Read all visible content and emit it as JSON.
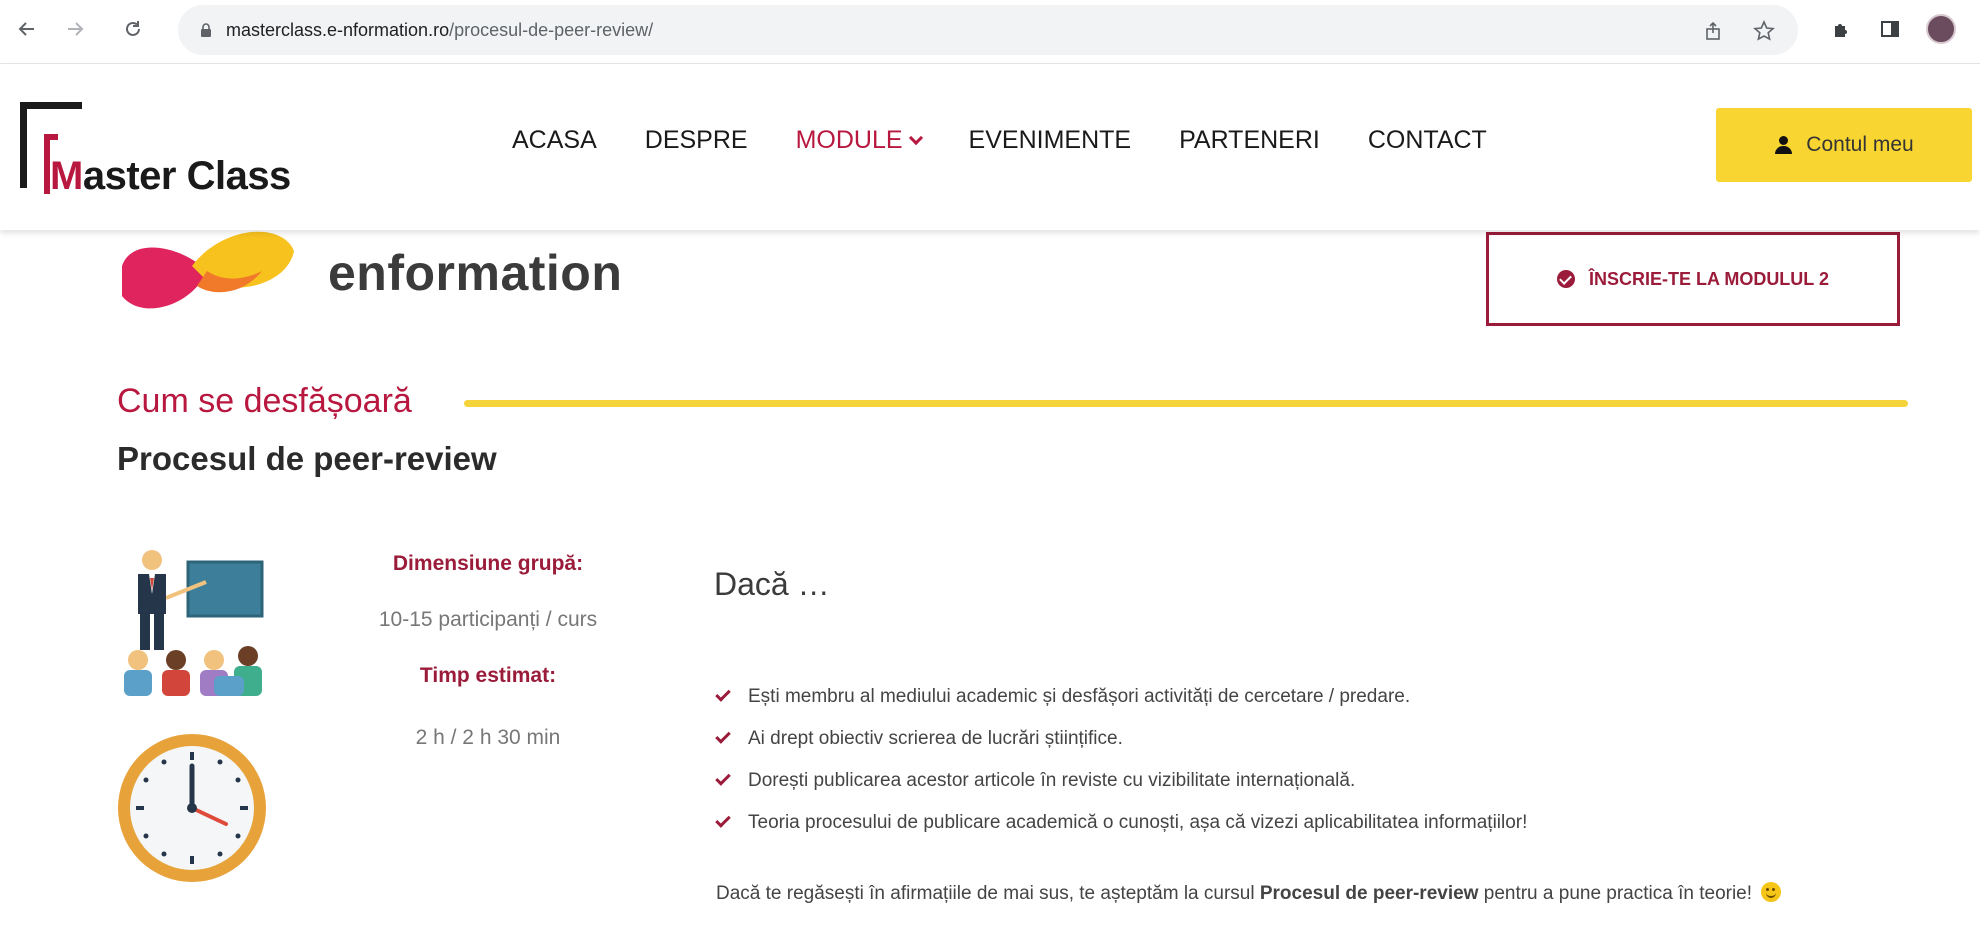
{
  "browser": {
    "url_domain": "masterclass.e-nformation.ro",
    "url_path": "/procesul-de-peer-review/",
    "icons": [
      "back-arrow-icon",
      "forward-arrow-icon",
      "reload-icon",
      "lock-icon",
      "share-icon",
      "star-icon",
      "puzzle-extension-icon",
      "side-panel-icon",
      "profile-avatar-icon"
    ]
  },
  "header": {
    "logo_text_m": "M",
    "logo_text_rest": "aster Class",
    "nav": [
      {
        "label": "ACASA"
      },
      {
        "label": "DESPRE"
      },
      {
        "label": "MODULE"
      },
      {
        "label": "EVENIMENTE"
      },
      {
        "label": "PARTENERI"
      },
      {
        "label": "CONTACT"
      }
    ],
    "account_label": "Contul meu"
  },
  "hero": {
    "brand_text": "enformation",
    "enroll_label": "ÎNSCRIE-TE LA MODULUL 2"
  },
  "section": {
    "subtitle": "Cum se desfășoară",
    "title": "Procesul de peer-review"
  },
  "meta": {
    "group_label": "Dimensiune grupă:",
    "group_value": "10-15 participanți / curs",
    "time_label": "Timp estimat:",
    "time_value": "2 h / 2 h 30 min"
  },
  "content": {
    "heading": "Dacă …",
    "items": [
      "Ești membru al mediului academic și desfășori activități de cercetare / predare.",
      "Ai drept obiectiv scrierea de lucrări științifice.",
      "Dorești publicarea acestor articole în reviste cu vizibilitate internațională.",
      "Teoria procesului de publicare academică o cunoști, așa că vizezi aplicabilitatea informațiilor!"
    ],
    "closing_pre": "Dacă te regăsești în afirmațiile de mai sus, te așteptăm la cursul ",
    "closing_bold": "Procesul de peer-review",
    "closing_post": " pentru a pune practica în teorie!"
  },
  "colors": {
    "brand_red": "#b8183f",
    "dark_red": "#9b1c3a",
    "yellow": "#f9d532"
  }
}
